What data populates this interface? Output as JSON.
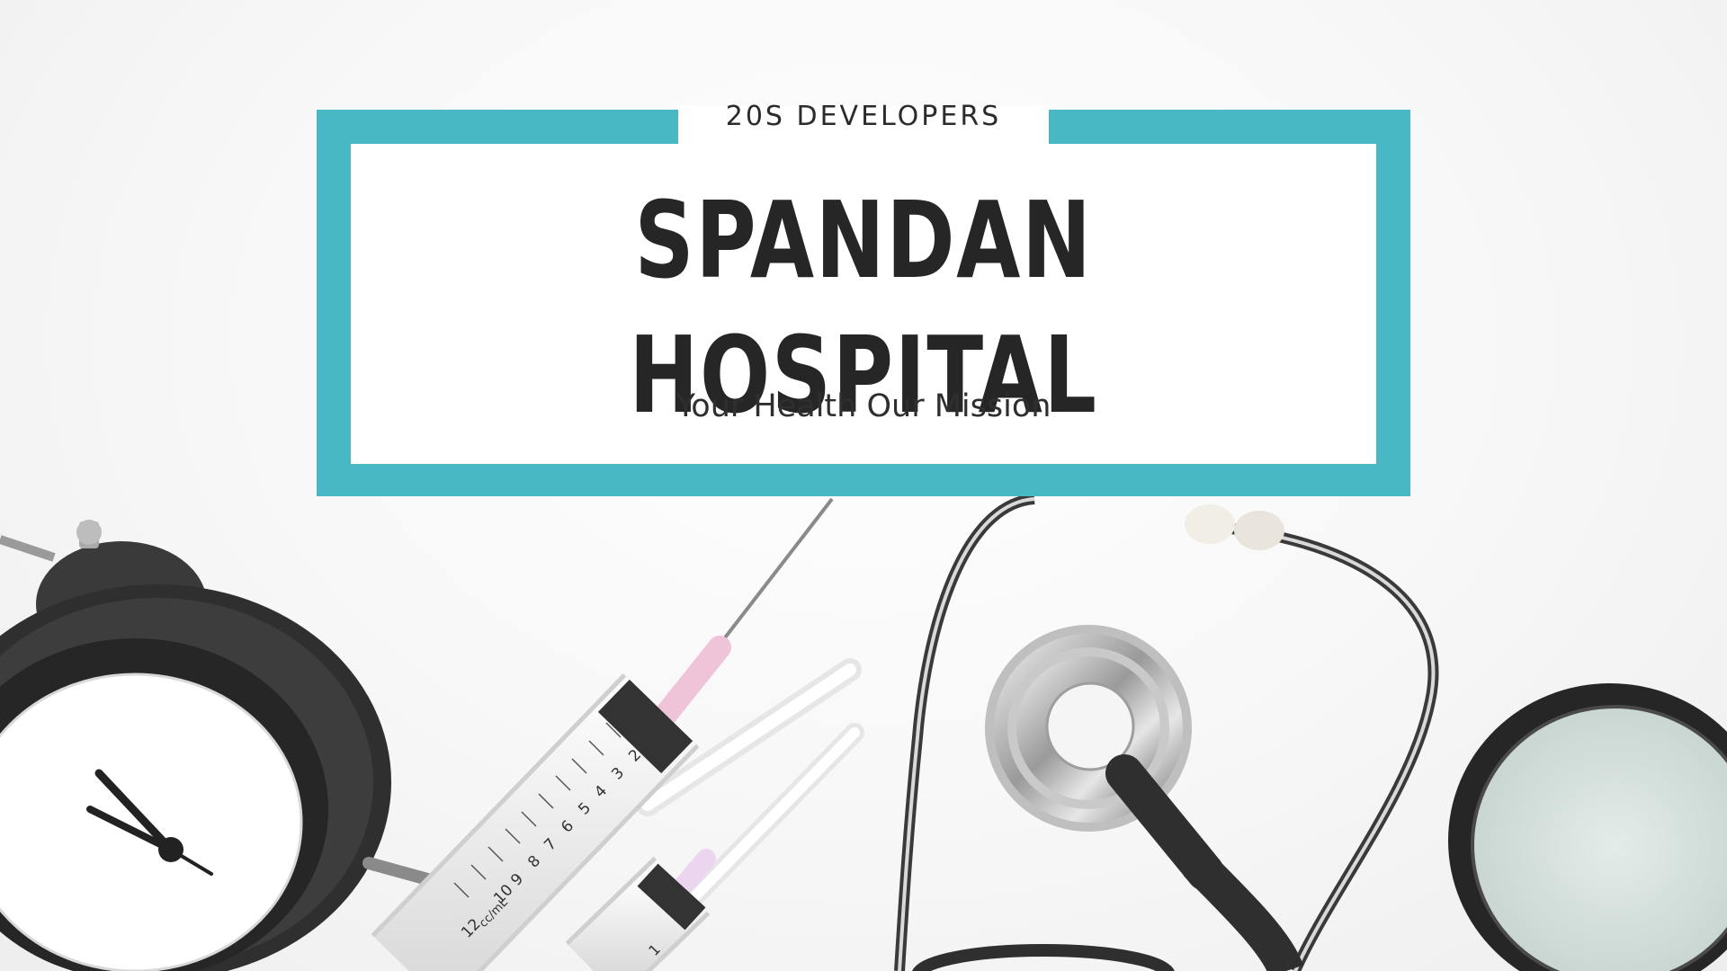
{
  "banner": {
    "eyebrow": "20S DEVELOPERS",
    "title": "SPANDAN HOSPITAL",
    "tagline": "Your Health Our Mission"
  },
  "colors": {
    "accent": "#48b9c4",
    "text": "#262626",
    "background": "#f7f7f7"
  },
  "syringe_large": {
    "scale_labels": [
      "2",
      "3",
      "4",
      "5",
      "6",
      "7",
      "8",
      "9",
      "10",
      "12"
    ],
    "unit_label": "cc/mL"
  },
  "syringe_small": {
    "scale_labels": [
      "1"
    ]
  },
  "photo_objects": [
    "alarm-clock",
    "syringe",
    "needle-caps",
    "stethoscope",
    "magnifying-glass"
  ]
}
